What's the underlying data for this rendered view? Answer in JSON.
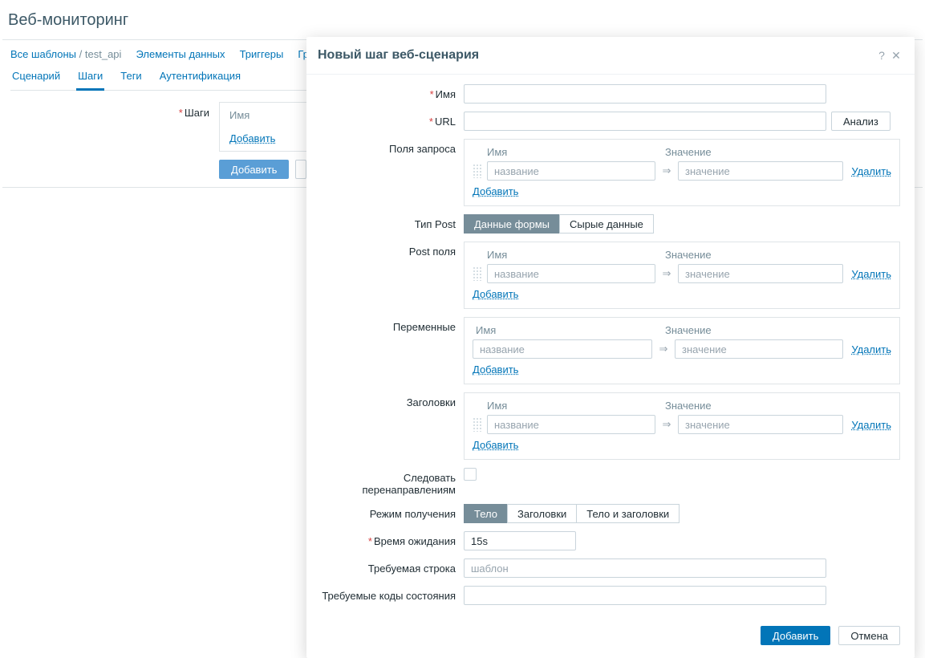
{
  "page": {
    "title": "Веб-мониторинг"
  },
  "breadcrumb": {
    "all_templates": "Все шаблоны",
    "template_name": "test_api",
    "items_nav": "Элементы данных",
    "triggers_nav": "Триггеры",
    "graphs_nav": "Графики"
  },
  "tabs": {
    "scenario": "Сценарий",
    "steps": "Шаги",
    "tags": "Теги",
    "auth": "Аутентификация"
  },
  "back_form": {
    "steps_label": "Шаги",
    "name_header": "Имя",
    "add_link": "Добавить",
    "submit": "Добавить"
  },
  "dialog": {
    "title": "Новый шаг веб-сценария",
    "name_label": "Имя",
    "url_label": "URL",
    "analyze_btn": "Анализ",
    "query_label": "Поля запроса",
    "post_type_label": "Тип Post",
    "post_type_form": "Данные формы",
    "post_type_raw": "Сырые данные",
    "post_fields_label": "Post поля",
    "variables_label": "Переменные",
    "headers_label": "Заголовки",
    "kv_name_header": "Имя",
    "kv_value_header": "Значение",
    "kv_name_ph": "название",
    "kv_value_ph": "значение",
    "kv_delete": "Удалить",
    "kv_add": "Добавить",
    "follow_redirects_label": "Следовать перенаправлениям",
    "retrieve_mode_label": "Режим получения",
    "retrieve_body": "Тело",
    "retrieve_headers": "Заголовки",
    "retrieve_both": "Тело и заголовки",
    "timeout_label": "Время ожидания",
    "timeout_value": "15s",
    "required_string_label": "Требуемая строка",
    "required_string_ph": "шаблон",
    "status_codes_label": "Требуемые коды состояния",
    "footer_add": "Добавить",
    "footer_cancel": "Отмена"
  }
}
